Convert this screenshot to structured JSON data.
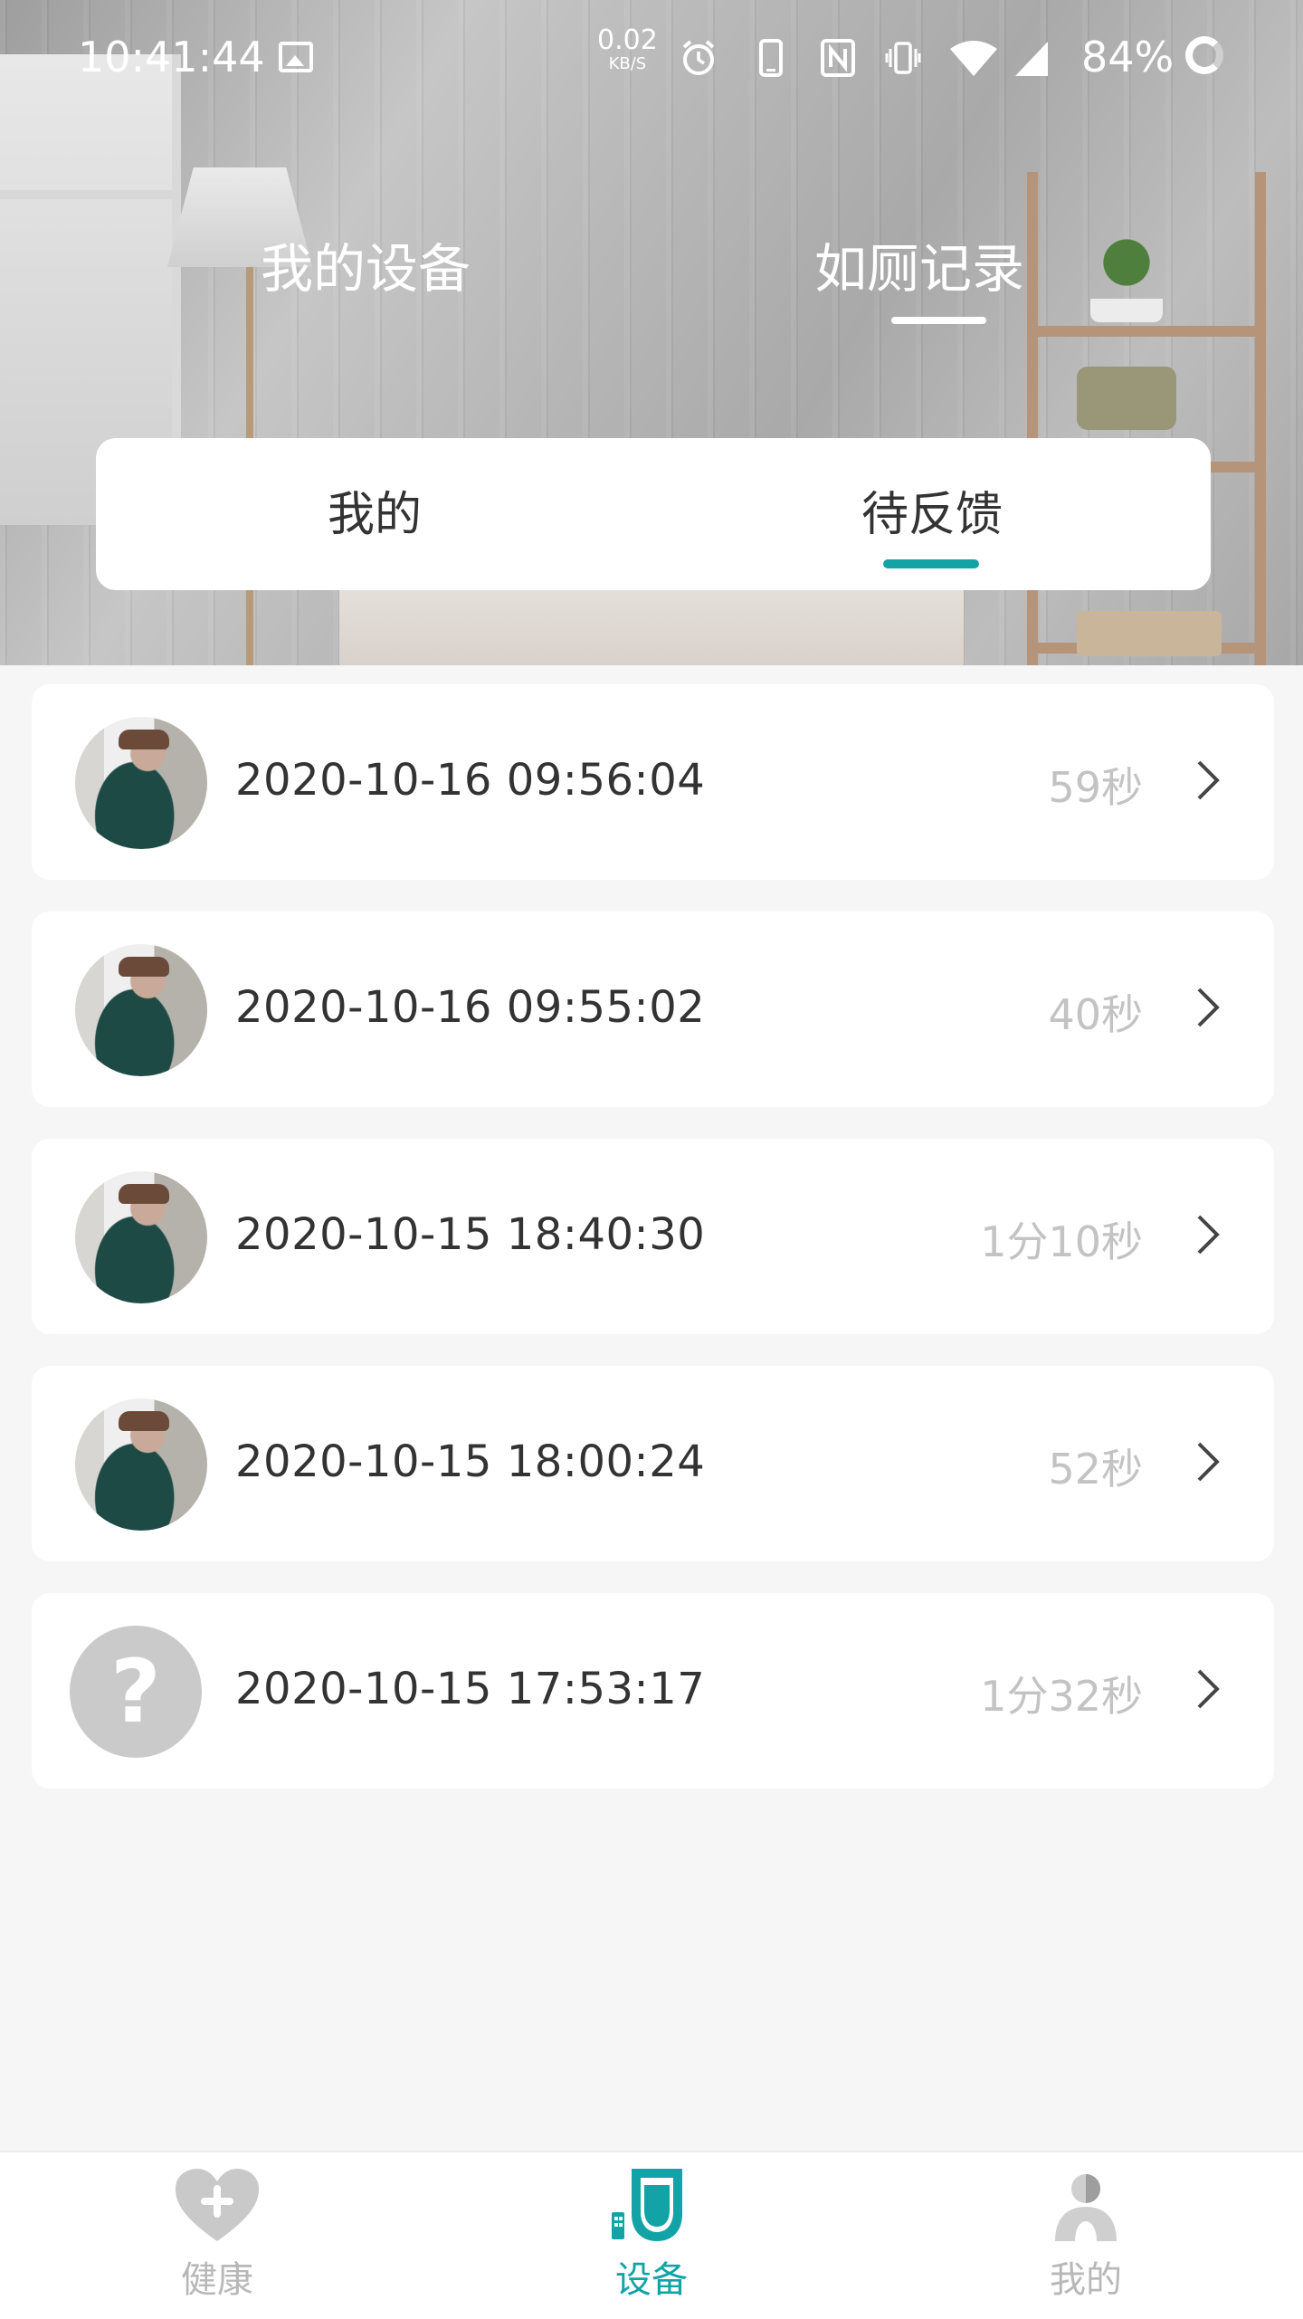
{
  "status_bar": {
    "time": "10:41:44",
    "net_speed_value": "0.02",
    "net_speed_unit": "KB/S",
    "battery": "84%"
  },
  "top_tabs": {
    "my_devices": "我的设备",
    "toilet_records": "如厕记录",
    "active": "toilet_records"
  },
  "segments": {
    "mine": "我的",
    "pending": "待反馈",
    "active": "pending"
  },
  "records": [
    {
      "datetime": "2020-10-16 09:56:04",
      "duration": "59秒",
      "avatar": "photo"
    },
    {
      "datetime": "2020-10-16 09:55:02",
      "duration": "40秒",
      "avatar": "photo"
    },
    {
      "datetime": "2020-10-15 18:40:30",
      "duration": "1分10秒",
      "avatar": "photo"
    },
    {
      "datetime": "2020-10-15 18:00:24",
      "duration": "52秒",
      "avatar": "photo"
    },
    {
      "datetime": "2020-10-15 17:53:17",
      "duration": "1分32秒",
      "avatar": "unknown",
      "unknown_glyph": "?"
    }
  ],
  "bottom_nav": {
    "health": "健康",
    "device": "设备",
    "mine": "我的",
    "active": "device"
  },
  "colors": {
    "accent": "#13a3a6",
    "inactive": "#b8b8b8",
    "duration_text": "#c3c3c3",
    "background": "#f6f6f6"
  },
  "icons": {
    "status": [
      "image-icon",
      "alarm-icon",
      "phone-icon",
      "nfc-icon",
      "vibrate-icon",
      "wifi-icon",
      "signal-icon",
      "battery-ring-icon"
    ],
    "nav": [
      "heart-plus-icon",
      "toilet-icon",
      "user-icon"
    ],
    "row": "chevron-right-icon"
  }
}
